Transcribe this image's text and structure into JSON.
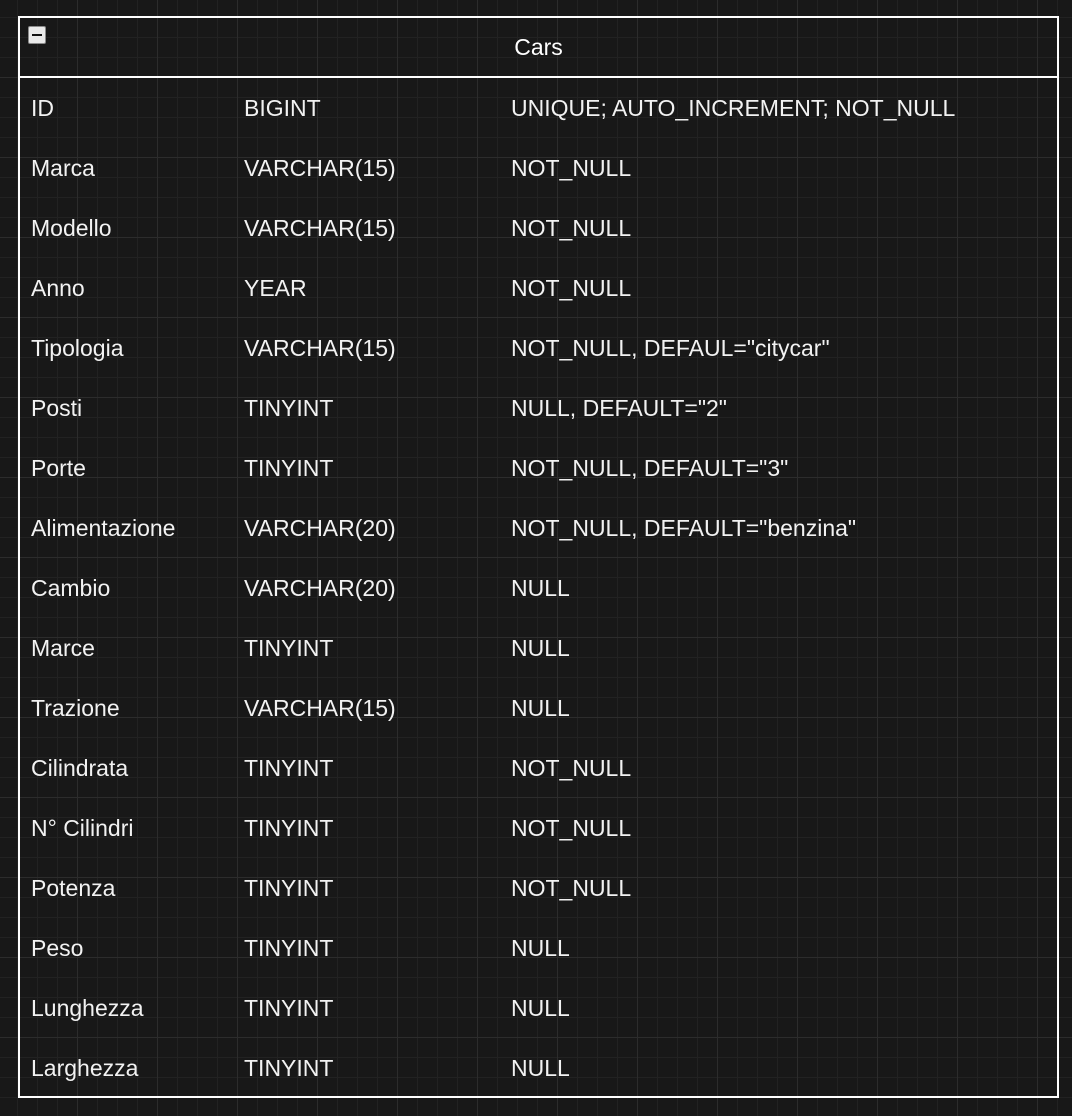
{
  "table": {
    "title": "Cars",
    "rows": [
      {
        "name": "ID",
        "type": "BIGINT",
        "constraints": "UNIQUE; AUTO_INCREMENT; NOT_NULL"
      },
      {
        "name": "Marca",
        "type": "VARCHAR(15)",
        "constraints": "NOT_NULL"
      },
      {
        "name": "Modello",
        "type": "VARCHAR(15)",
        "constraints": "NOT_NULL"
      },
      {
        "name": "Anno",
        "type": "YEAR",
        "constraints": "NOT_NULL"
      },
      {
        "name": "Tipologia",
        "type": "VARCHAR(15)",
        "constraints": "NOT_NULL, DEFAUL=\"citycar\""
      },
      {
        "name": "Posti",
        "type": "TINYINT",
        "constraints": "NULL, DEFAULT=\"2\""
      },
      {
        "name": "Porte",
        "type": "TINYINT",
        "constraints": "NOT_NULL, DEFAULT=\"3\""
      },
      {
        "name": "Alimentazione",
        "type": "VARCHAR(20)",
        "constraints": "NOT_NULL, DEFAULT=\"benzina\""
      },
      {
        "name": "Cambio",
        "type": "VARCHAR(20)",
        "constraints": "NULL"
      },
      {
        "name": "Marce",
        "type": "TINYINT",
        "constraints": "NULL"
      },
      {
        "name": "Trazione",
        "type": "VARCHAR(15)",
        "constraints": "NULL"
      },
      {
        "name": "Cilindrata",
        "type": "TINYINT",
        "constraints": "NOT_NULL"
      },
      {
        "name": "N° Cilindri",
        "type": "TINYINT",
        "constraints": "NOT_NULL"
      },
      {
        "name": "Potenza",
        "type": "TINYINT",
        "constraints": "NOT_NULL"
      },
      {
        "name": "Peso",
        "type": "TINYINT",
        "constraints": "NULL"
      },
      {
        "name": "Lunghezza",
        "type": "TINYINT",
        "constraints": "NULL"
      },
      {
        "name": "Larghezza",
        "type": "TINYINT",
        "constraints": "NULL"
      }
    ]
  },
  "icons": {
    "collapse": "minus-square-icon"
  },
  "colors": {
    "canvas_background": "#181818",
    "border": "#ffffff",
    "text": "#f2f2f2"
  }
}
